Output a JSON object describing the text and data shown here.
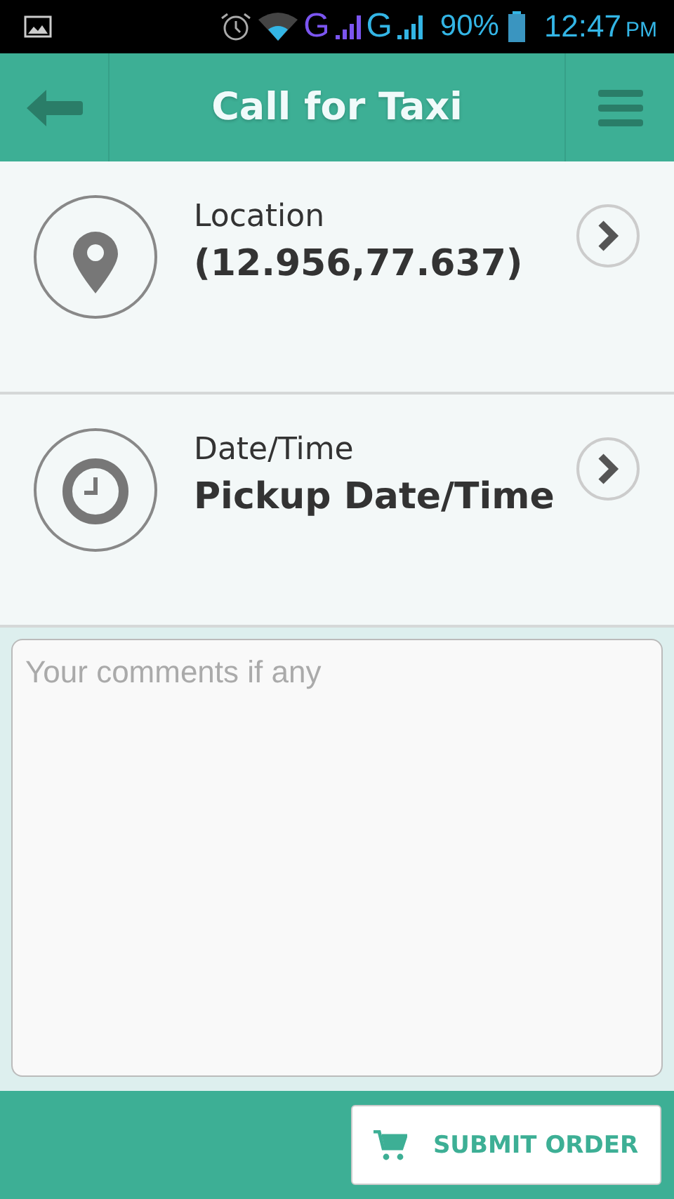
{
  "status_bar": {
    "network_1": "G",
    "network_2": "G",
    "battery": "90%",
    "time": "12:47",
    "meridiem": "PM"
  },
  "header": {
    "title": "Call for Taxi"
  },
  "rows": [
    {
      "kind": "location",
      "label": "Location",
      "value": "(12.956,77.637)"
    },
    {
      "kind": "datetime",
      "label": "Date/Time",
      "value": "Pickup Date/Time"
    }
  ],
  "comments": {
    "placeholder": "Your comments if any"
  },
  "submit": {
    "label": "SUBMIT ORDER"
  }
}
